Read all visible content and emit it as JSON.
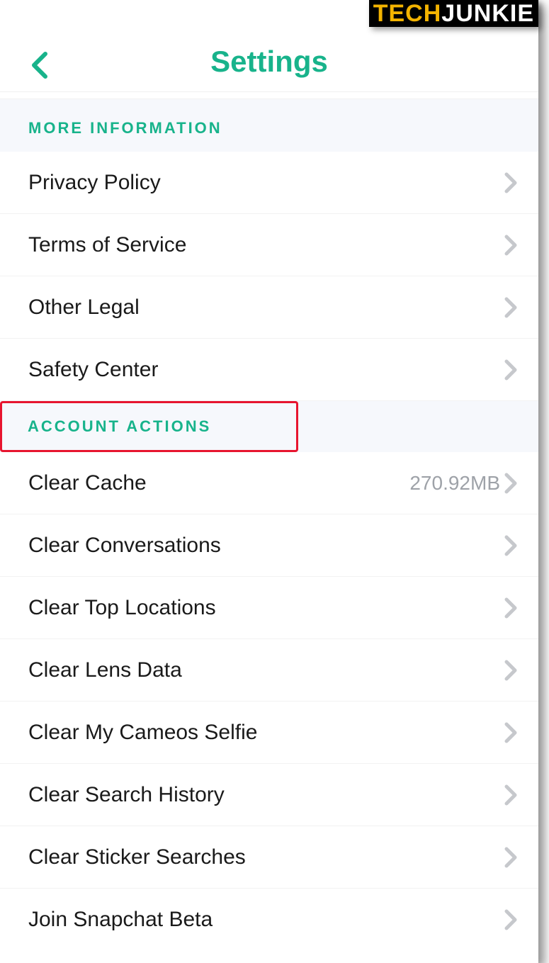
{
  "watermark": {
    "part_a": "TECH",
    "part_b": "JUNKIE"
  },
  "header": {
    "title": "Settings"
  },
  "sections": {
    "more_info": {
      "title": "MORE INFORMATION",
      "items": {
        "privacy": "Privacy Policy",
        "terms": "Terms of Service",
        "other_legal": "Other Legal",
        "safety": "Safety Center"
      }
    },
    "account_actions": {
      "title": "ACCOUNT ACTIONS",
      "items": {
        "clear_cache": {
          "label": "Clear Cache",
          "value": "270.92MB"
        },
        "clear_conversations": "Clear Conversations",
        "clear_top_locations": "Clear Top Locations",
        "clear_lens_data": "Clear Lens Data",
        "clear_cameos": "Clear My Cameos Selfie",
        "clear_search_history": "Clear Search History",
        "clear_sticker_searches": "Clear Sticker Searches",
        "join_beta": "Join Snapchat Beta"
      }
    }
  }
}
